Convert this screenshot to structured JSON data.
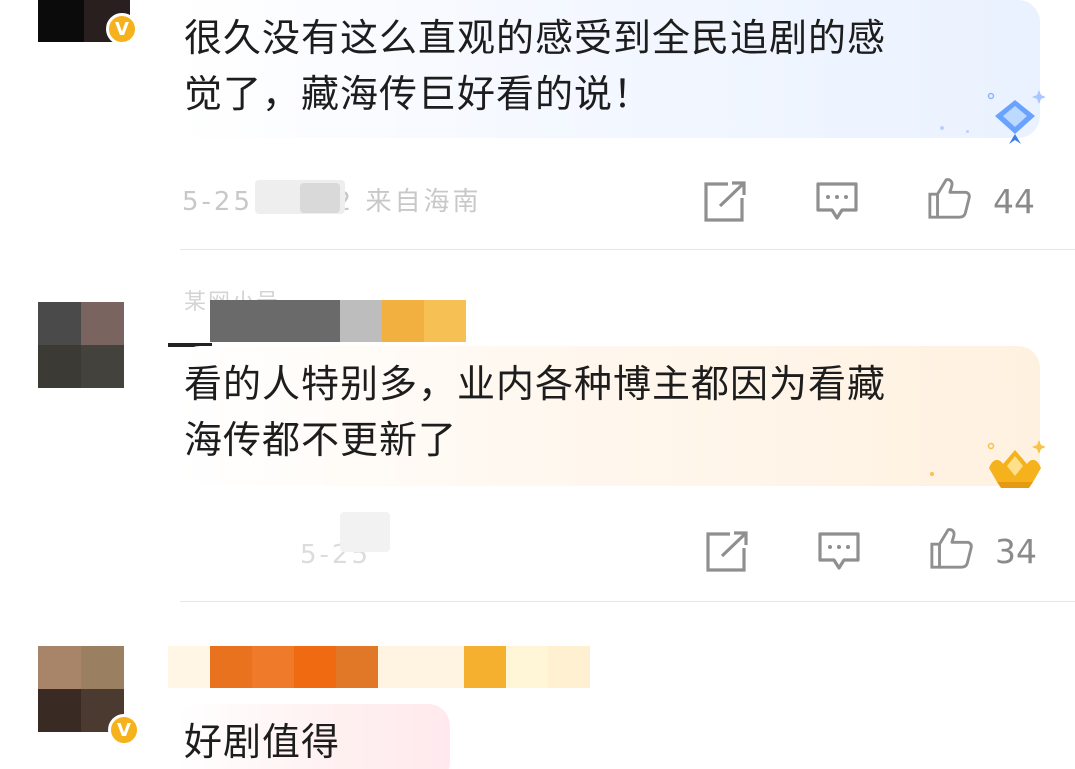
{
  "comments": [
    {
      "text_line1": "很久没有这么直观的感受到全民追剧的感",
      "text_line2": "觉了，藏海传巨好看的说！",
      "meta": "5-25 01:02 来自海南",
      "likes": "44",
      "verified_badge": "V"
    },
    {
      "name_hint": "某网小号",
      "text_line1": "看的人特别多，业内各种博主都因为看藏",
      "text_line2": "海传都不更新了",
      "meta": "5-25",
      "likes": "34"
    },
    {
      "name_hint": "某某",
      "text_line1": "好剧值得",
      "verified_badge": "V"
    }
  ],
  "icons": {
    "share": "share-icon",
    "comment": "comment-icon",
    "like": "thumbs-up-icon",
    "gem_blue": "blue-diamond-badge-icon",
    "gem_gold": "gold-crown-badge-icon"
  },
  "colors": {
    "verified": "#f6b21c",
    "count": "#8a8a8a",
    "icon": "#8f8f8f"
  }
}
